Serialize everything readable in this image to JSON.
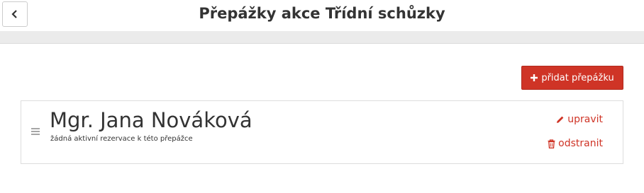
{
  "header": {
    "title": "Přepážky akce Třídní schůzky",
    "back_icon": "chevron-left-icon"
  },
  "toolbar": {
    "add_label": "přidat přepážku",
    "add_icon": "plus-icon"
  },
  "counters": [
    {
      "name": "Mgr. Jana Nováková",
      "note": "žádná aktivní rezervace k této přepážce",
      "edit_label": "upravit",
      "edit_icon": "pencil-icon",
      "delete_label": "odstranit",
      "delete_icon": "trash-icon"
    }
  ],
  "colors": {
    "accent": "#cf3426",
    "band": "#ebebeb",
    "text": "#333333"
  }
}
